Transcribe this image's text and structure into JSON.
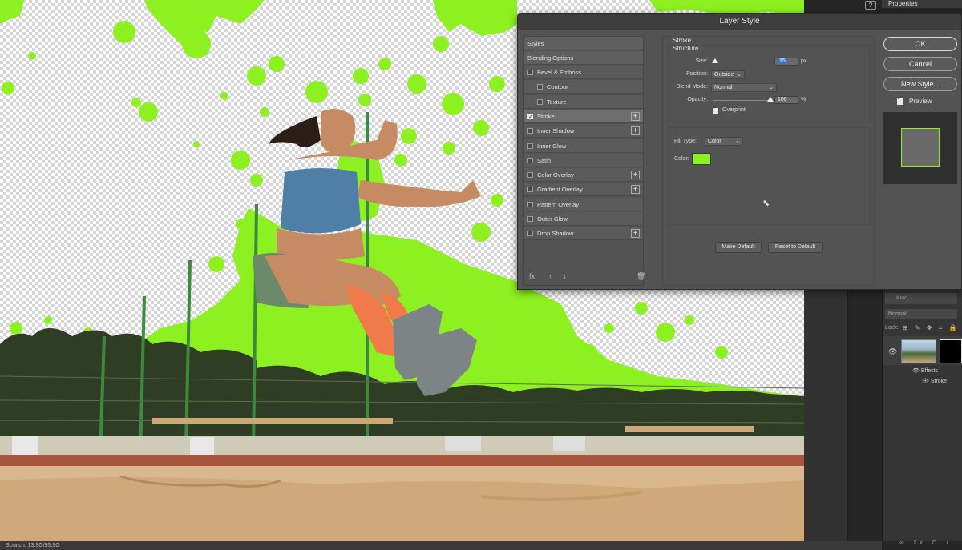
{
  "dialog": {
    "title": "Layer Style",
    "styles_header": "Styles",
    "blending_options": "Blending Options",
    "effects": [
      {
        "label": "Bevel & Emboss",
        "checked": false,
        "plus": false,
        "indent": 0
      },
      {
        "label": "Contour",
        "checked": false,
        "plus": false,
        "indent": 1
      },
      {
        "label": "Texture",
        "checked": false,
        "plus": false,
        "indent": 1
      },
      {
        "label": "Stroke",
        "checked": true,
        "plus": true,
        "indent": 0,
        "active": true
      },
      {
        "label": "Inner Shadow",
        "checked": false,
        "plus": true,
        "indent": 0
      },
      {
        "label": "Inner Glow",
        "checked": false,
        "plus": false,
        "indent": 0
      },
      {
        "label": "Satin",
        "checked": false,
        "plus": false,
        "indent": 0
      },
      {
        "label": "Color Overlay",
        "checked": false,
        "plus": true,
        "indent": 0
      },
      {
        "label": "Gradient Overlay",
        "checked": false,
        "plus": true,
        "indent": 0
      },
      {
        "label": "Pattern Overlay",
        "checked": false,
        "plus": false,
        "indent": 0
      },
      {
        "label": "Outer Glow",
        "checked": false,
        "plus": false,
        "indent": 0
      },
      {
        "label": "Drop Shadow",
        "checked": false,
        "plus": true,
        "indent": 0
      }
    ],
    "footer_icons": [
      "fx",
      "↑",
      "↓",
      "🗑"
    ],
    "stroke": {
      "section_title": "Stroke",
      "structure_title": "Structure",
      "size_label": "Size:",
      "size_value": "15",
      "size_unit": "px",
      "size_fraction": 0.04,
      "position_label": "Position:",
      "position_value": "Outside",
      "blend_mode_label": "Blend Mode:",
      "blend_mode_value": "Normal",
      "opacity_label": "Opacity:",
      "opacity_value": "100",
      "opacity_unit": "%",
      "opacity_fraction": 1.0,
      "overprint_label": "Overprint",
      "fill_type_label": "Fill Type:",
      "fill_type_value": "Color",
      "color_label": "Color:",
      "color_value": "#8df020",
      "make_default": "Make Default",
      "reset_default": "Reset to Default"
    },
    "buttons": {
      "ok": "OK",
      "cancel": "Cancel",
      "new_style": "New Style..."
    },
    "preview_label": "Preview"
  },
  "right_panel": {
    "help_icon": "?",
    "properties_tab": "Properties",
    "search_placeholder": "Kind",
    "blend_mode": "Normal",
    "lock_label": "Lock:",
    "lock_icons": "⊞ ✎ ✥ ⌗ 🔒",
    "layer_effects": "Effects",
    "layer_stroke": "Stroke",
    "bottom_icons": "∞ fx ◘ ◐"
  },
  "status": {
    "text": "Scratch: 13.9G/95.9G"
  },
  "colors": {
    "accent_stroke": "#8df020",
    "dialog_bg": "#535353"
  }
}
